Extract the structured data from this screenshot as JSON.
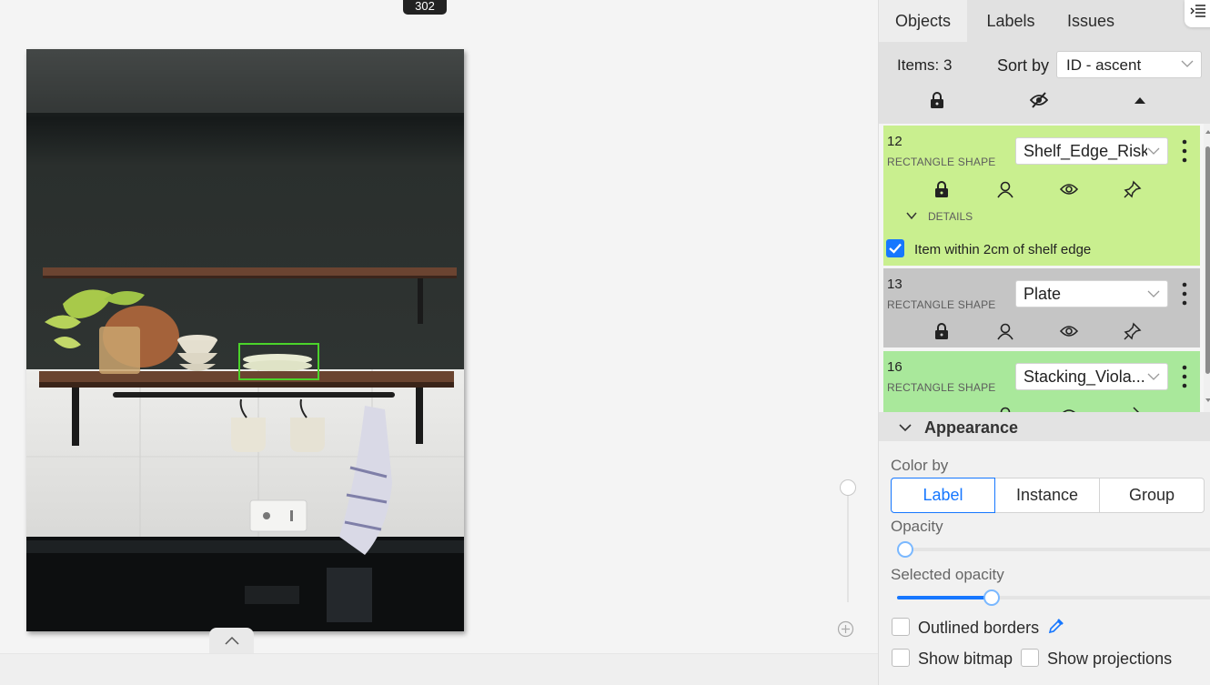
{
  "canvas": {
    "frame_badge": "302"
  },
  "sidebar": {
    "tabs": [
      {
        "label": "Objects"
      },
      {
        "label": "Labels"
      },
      {
        "label": "Issues"
      }
    ],
    "items_count": "Items: 3",
    "sort_label": "Sort by",
    "sort_value": "ID - ascent",
    "objects": [
      {
        "id": "12",
        "type": "RECTANGLE SHAPE",
        "label": "Shelf_Edge_Risk",
        "color": "#c9ef8f",
        "details_label": "DETAILS",
        "attribute_label": "Item within 2cm of shelf edge",
        "attribute_checked": true
      },
      {
        "id": "13",
        "type": "RECTANGLE SHAPE",
        "label": "Plate",
        "color": "#c5c5c5"
      },
      {
        "id": "16",
        "type": "RECTANGLE SHAPE",
        "label": "Stacking_Viola...",
        "color": "#a9e89b"
      }
    ]
  },
  "appearance": {
    "title": "Appearance",
    "color_by_label": "Color by",
    "color_by_options": [
      "Label",
      "Instance",
      "Group"
    ],
    "color_by_selected": "Label",
    "opacity_label": "Opacity",
    "opacity_value": 0.03,
    "selected_opacity_label": "Selected opacity",
    "selected_opacity_value": 0.3,
    "outlined_borders_label": "Outlined borders",
    "outlined_borders_checked": false,
    "show_bitmap_label": "Show bitmap",
    "show_bitmap_checked": false,
    "show_projections_label": "Show projections",
    "show_projections_checked": false,
    "accent_color": "#1677ff",
    "bbox_color": "#4bd32a"
  }
}
